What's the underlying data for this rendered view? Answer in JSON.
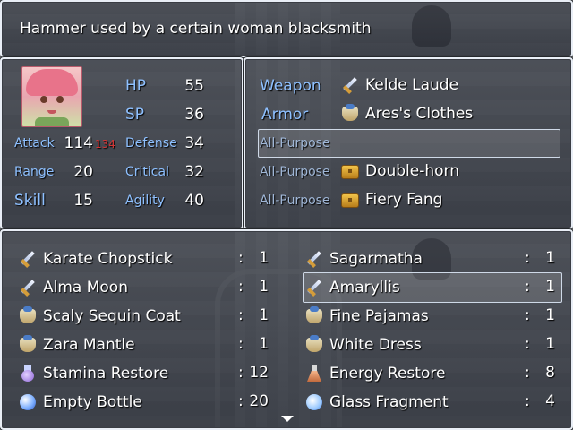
{
  "help": {
    "text": "Hammer used by a certain woman blacksmith"
  },
  "status": {
    "hp_label": "HP",
    "hp": "55",
    "sp_label": "SP",
    "sp": "36",
    "attack_label": "Attack",
    "attack": "114",
    "attack_new": "134",
    "defense_label": "Defense",
    "defense": "34",
    "range_label": "Range",
    "range": "20",
    "critical_label": "Critical",
    "critical": "32",
    "skill_label": "Skill",
    "skill": "15",
    "agility_label": "Agility",
    "agility": "40"
  },
  "equipment": [
    {
      "slot": "Weapon",
      "name": "Kelde Laude",
      "icon": "sword-icon"
    },
    {
      "slot": "Armor",
      "name": "Ares's Clothes",
      "icon": "armor-icon"
    },
    {
      "slot": "All-Purpose",
      "name": "",
      "icon": ""
    },
    {
      "slot": "All-Purpose",
      "name": "Double-horn",
      "icon": "chest-icon"
    },
    {
      "slot": "All-Purpose",
      "name": "Fiery Fang",
      "icon": "chest-icon"
    }
  ],
  "inventory": [
    {
      "name": "Karate Chopstick",
      "count": "1",
      "icon": "sword-icon"
    },
    {
      "name": "Sagarmatha",
      "count": "1",
      "icon": "sword-icon"
    },
    {
      "name": "Alma Moon",
      "count": "1",
      "icon": "sword-icon"
    },
    {
      "name": "Amaryllis",
      "count": "1",
      "icon": "sword-icon"
    },
    {
      "name": "Scaly Sequin Coat",
      "count": "1",
      "icon": "armor-icon"
    },
    {
      "name": "Fine Pajamas",
      "count": "1",
      "icon": "armor-icon"
    },
    {
      "name": "Zara Mantle",
      "count": "1",
      "icon": "armor-icon"
    },
    {
      "name": "White Dress",
      "count": "1",
      "icon": "armor-icon"
    },
    {
      "name": "Stamina Restore",
      "count": "12",
      "icon": "potion-icon"
    },
    {
      "name": "Energy Restore",
      "count": "8",
      "icon": "flask-icon"
    },
    {
      "name": "Empty Bottle",
      "count": "20",
      "icon": "orb-icon"
    },
    {
      "name": "Glass Fragment",
      "count": "4",
      "icon": "shard-icon"
    }
  ],
  "colon": ":",
  "colors": {
    "label": "#8ec0ff",
    "stat_up": "#d23535"
  }
}
